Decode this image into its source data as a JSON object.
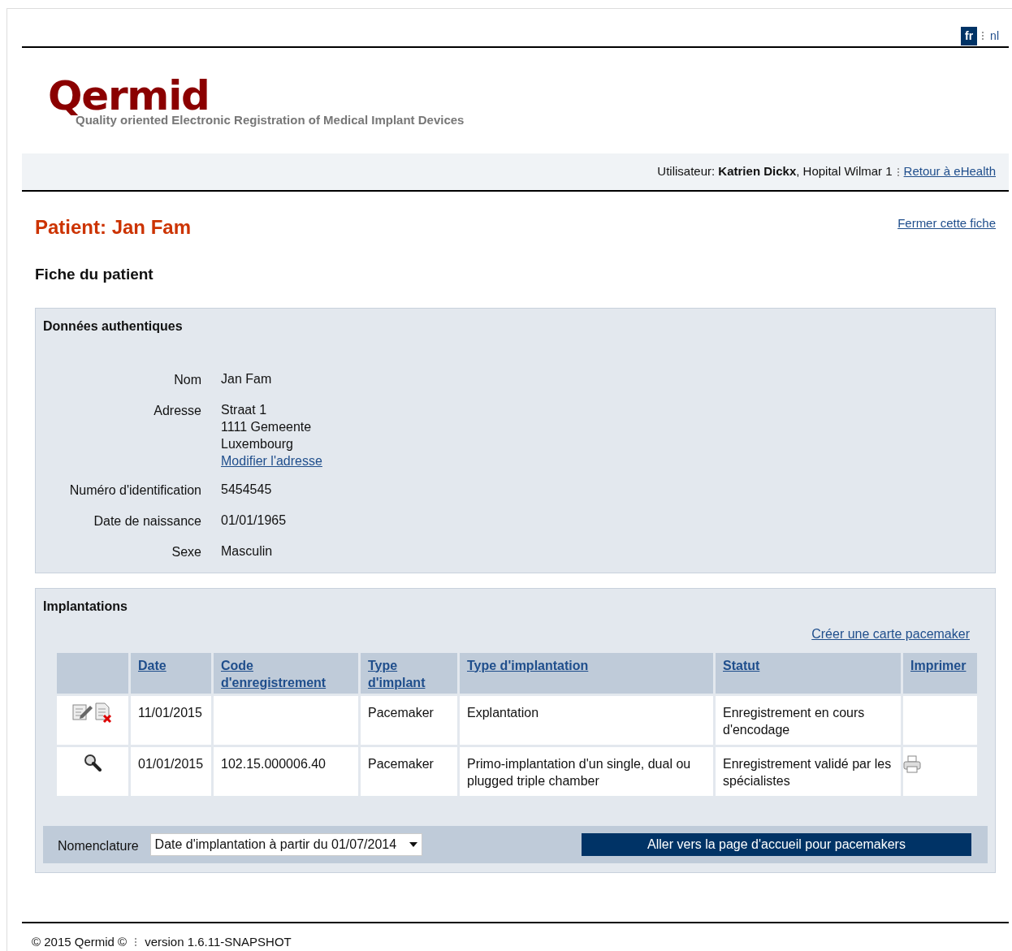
{
  "languages": [
    {
      "label": "fr",
      "selected": true
    },
    {
      "label": "nl",
      "selected": false
    }
  ],
  "logo": {
    "name": "Qermid",
    "tagline": "Quality oriented Electronic Registration of Medical Implant Devices"
  },
  "user_bar": {
    "label": "Utilisateur:",
    "name": "Katrien Dickx",
    "organisation": ", Hopital Wilmar 1",
    "link": "Retour à eHealth"
  },
  "title": "Patient: Jan Fam",
  "close_link": "Fermer cette fiche",
  "subtitle": "Fiche du patient",
  "authentic": {
    "heading": "Données authentiques",
    "fields": [
      {
        "label": "Nom",
        "lines": [
          "Jan Fam"
        ]
      },
      {
        "label": "Adresse",
        "lines": [
          "Straat 1",
          "1111 Gemeente",
          "Luxembourg"
        ],
        "link": "Modifier l'adresse"
      },
      {
        "label": "Numéro d'identification",
        "lines": [
          "5454545"
        ]
      },
      {
        "label": "Date de naissance",
        "lines": [
          "01/01/1965"
        ]
      },
      {
        "label": "Sexe",
        "lines": [
          "Masculin"
        ]
      }
    ]
  },
  "implantations": {
    "heading": "Implantations",
    "create_link": "Créer une carte pacemaker",
    "columns": [
      "Date",
      "Code d'enregistrement",
      "Type d'implant",
      "Type d'implantation",
      "Statut",
      "Imprimer"
    ],
    "rows": [
      {
        "actions": [
          {
            "kind": "edit"
          },
          {
            "kind": "delete"
          }
        ],
        "cells": [
          "11/01/2015",
          "",
          "Pacemaker",
          "Explantation",
          "Enregistrement en cours d'encodage"
        ],
        "printable": false
      },
      {
        "actions": [
          {
            "kind": "view"
          }
        ],
        "cells": [
          "01/01/2015",
          "102.15.000006.40",
          "Pacemaker",
          "Primo-implantation d'un single, dual ou plugged triple chamber",
          "Enregistrement validé par les spécialistes"
        ],
        "printable": true
      }
    ],
    "nomenclature_label": "Nomenclature",
    "nomenclature_value": "Date d'implantation à partir du 01/07/2014",
    "home_button": "Aller vers la page d'accueil pour pacemakers"
  },
  "footer": {
    "copyright": "© 2015  Qermid ©",
    "version": "version 1.6.11-SNAPSHOT"
  }
}
